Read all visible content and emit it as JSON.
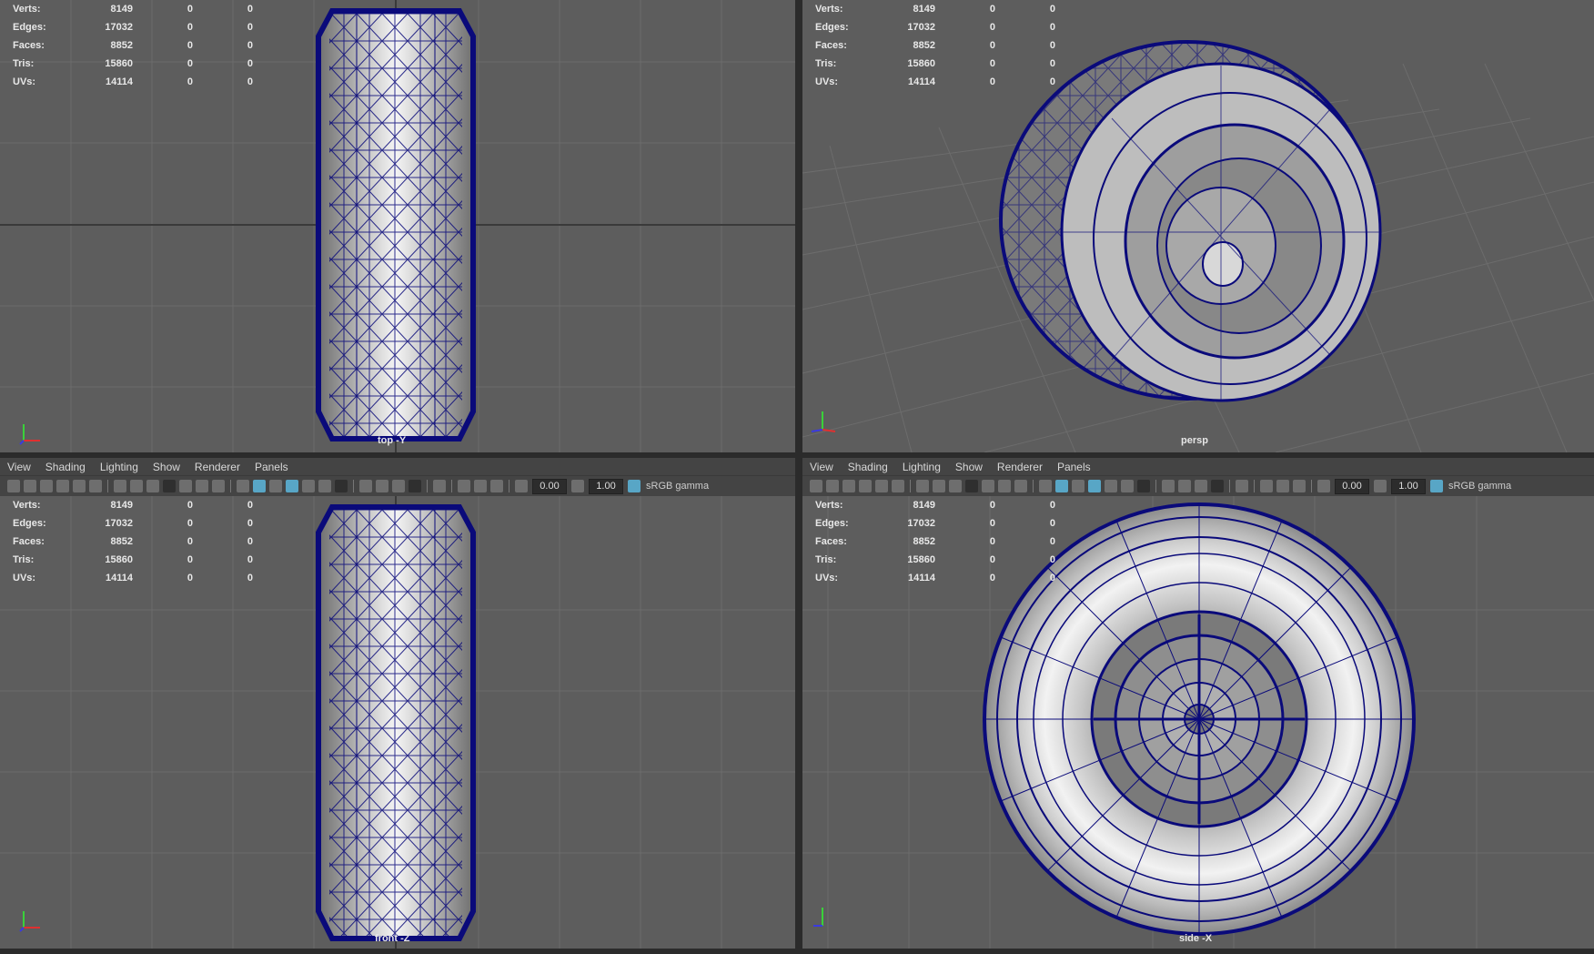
{
  "stats": {
    "rows": [
      {
        "label": "Verts:",
        "v1": "8149",
        "v2": "0",
        "v3": "0"
      },
      {
        "label": "Edges:",
        "v1": "17032",
        "v2": "0",
        "v3": "0"
      },
      {
        "label": "Faces:",
        "v1": "8852",
        "v2": "0",
        "v3": "0"
      },
      {
        "label": "Tris:",
        "v1": "15860",
        "v2": "0",
        "v3": "0"
      },
      {
        "label": "UVs:",
        "v1": "14114",
        "v2": "0",
        "v3": "0"
      }
    ]
  },
  "cameras": {
    "top": "top -Y",
    "persp": "persp",
    "front": "front -Z",
    "side": "side -X"
  },
  "menu": {
    "items": [
      "View",
      "Shading",
      "Lighting",
      "Show",
      "Renderer",
      "Panels"
    ]
  },
  "toolbar": {
    "exposure": "0.00",
    "gamma": "1.00",
    "colorspace": "sRGB gamma"
  },
  "colors": {
    "viewport_bg": "#5d5d5d",
    "grid": "#6c6c6c",
    "grid_axis": "#3a3a3a",
    "wire": "#0a0a7a",
    "surface": "#b8b8b8",
    "highlight": "#58a6c6"
  }
}
